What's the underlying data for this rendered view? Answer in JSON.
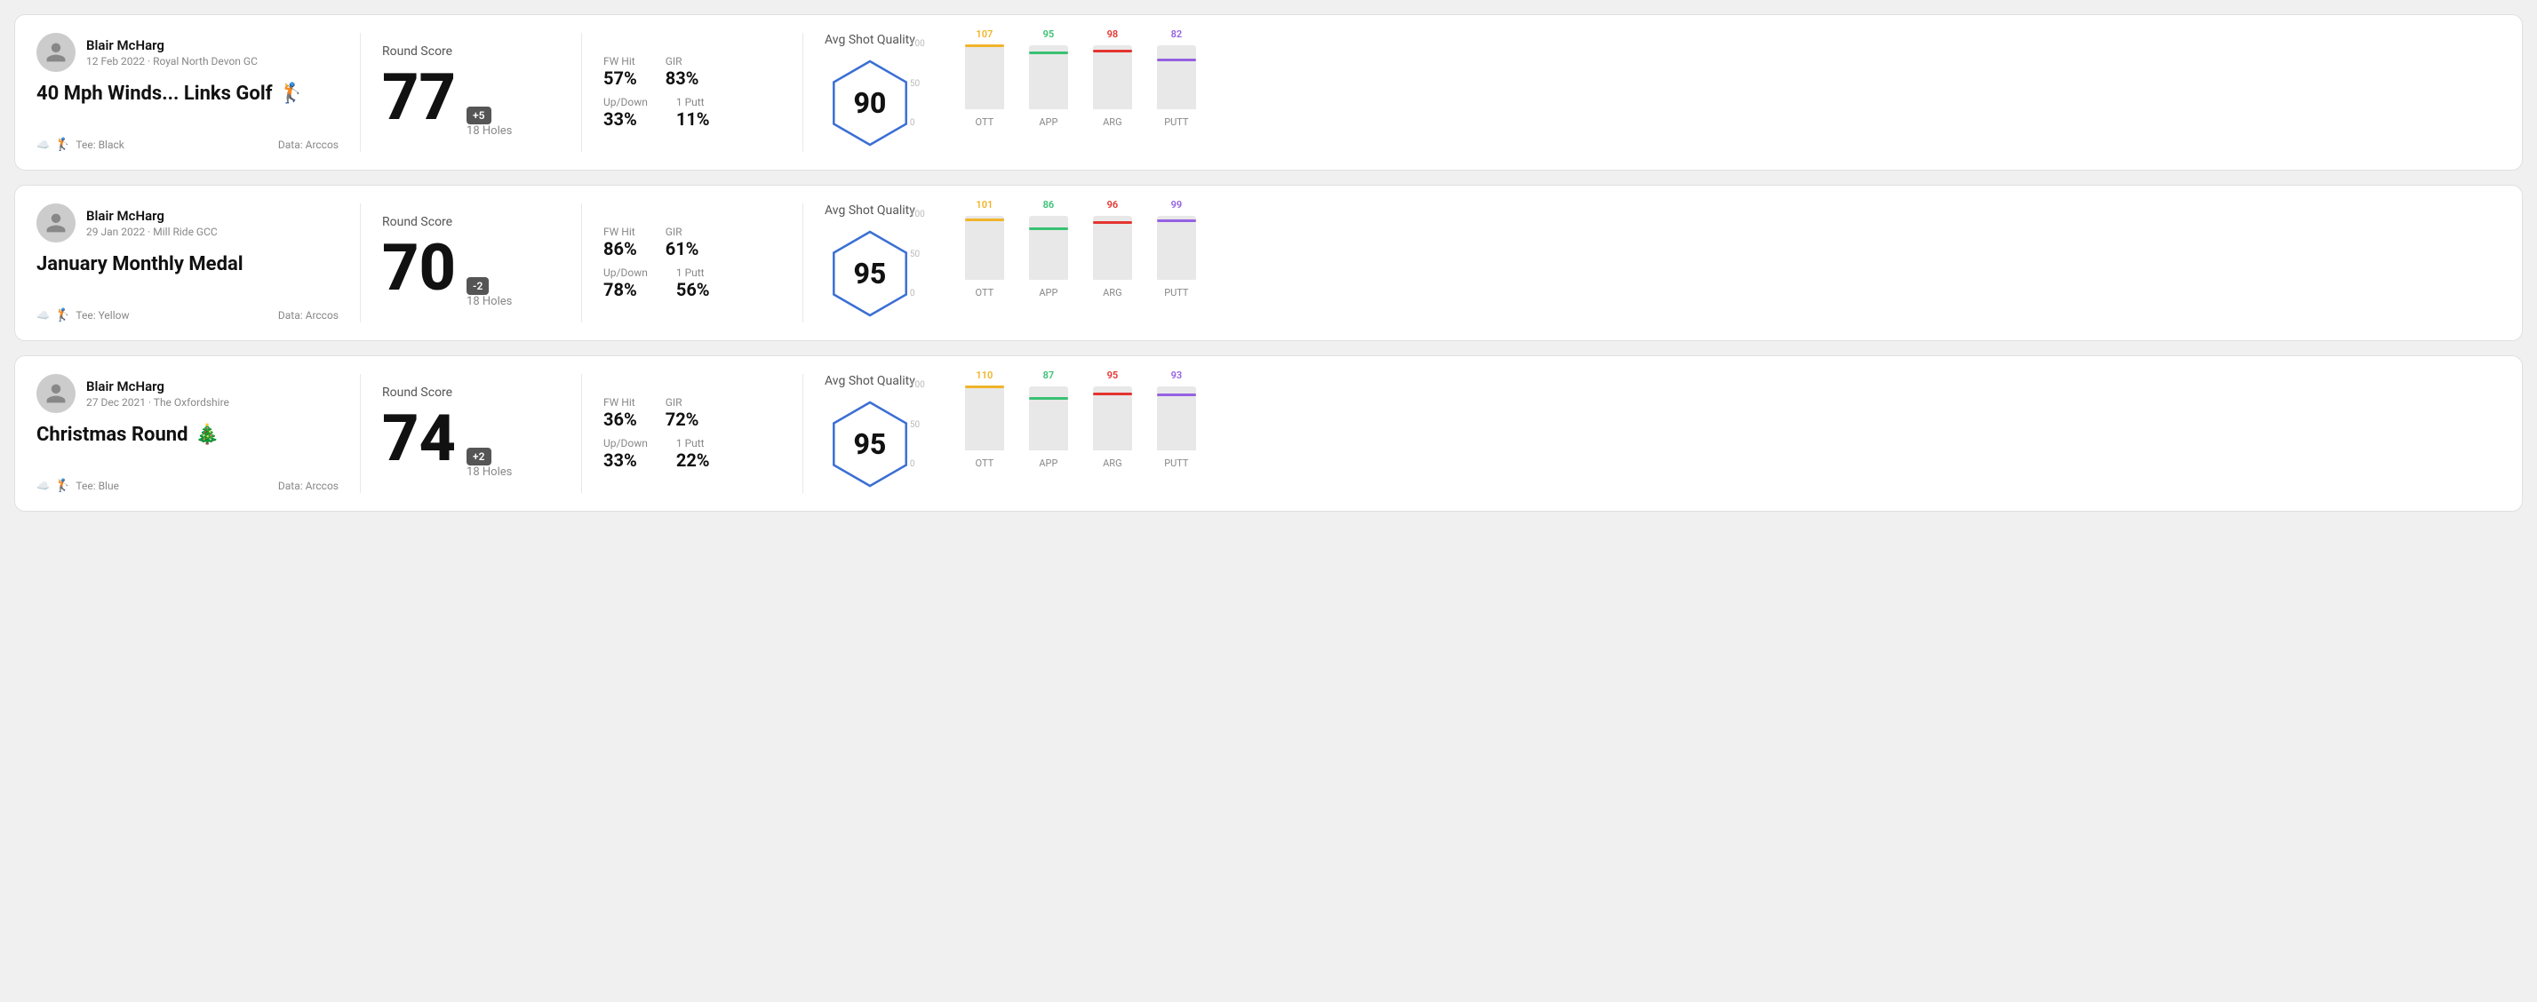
{
  "rounds": [
    {
      "id": "round1",
      "user_name": "Blair McHarg",
      "user_date": "12 Feb 2022 · Royal North Devon GC",
      "round_title": "40 Mph Winds... Links Golf",
      "round_title_emoji": "🏌️",
      "tee": "Tee: Black",
      "data_source": "Data: Arccos",
      "round_score_label": "Round Score",
      "score": "77",
      "score_badge": "+5",
      "holes": "18 Holes",
      "fw_hit_label": "FW Hit",
      "fw_hit_value": "57%",
      "gir_label": "GIR",
      "gir_value": "83%",
      "updown_label": "Up/Down",
      "updown_value": "33%",
      "oneputt_label": "1 Putt",
      "oneputt_value": "11%",
      "quality_label": "Avg Shot Quality",
      "quality_score": "90",
      "chart": {
        "bars": [
          {
            "label": "OTT",
            "value": 107,
            "color": "#f0b429"
          },
          {
            "label": "APP",
            "value": 95,
            "color": "#38c172"
          },
          {
            "label": "ARG",
            "value": 98,
            "color": "#e3342f"
          },
          {
            "label": "PUTT",
            "value": 82,
            "color": "#9561e2"
          }
        ],
        "y_max": 100,
        "y_labels": [
          "100",
          "50",
          "0"
        ]
      }
    },
    {
      "id": "round2",
      "user_name": "Blair McHarg",
      "user_date": "29 Jan 2022 · Mill Ride GCC",
      "round_title": "January Monthly Medal",
      "round_title_emoji": "",
      "tee": "Tee: Yellow",
      "data_source": "Data: Arccos",
      "round_score_label": "Round Score",
      "score": "70",
      "score_badge": "-2",
      "holes": "18 Holes",
      "fw_hit_label": "FW Hit",
      "fw_hit_value": "86%",
      "gir_label": "GIR",
      "gir_value": "61%",
      "updown_label": "Up/Down",
      "updown_value": "78%",
      "oneputt_label": "1 Putt",
      "oneputt_value": "56%",
      "quality_label": "Avg Shot Quality",
      "quality_score": "95",
      "chart": {
        "bars": [
          {
            "label": "OTT",
            "value": 101,
            "color": "#f0b429"
          },
          {
            "label": "APP",
            "value": 86,
            "color": "#38c172"
          },
          {
            "label": "ARG",
            "value": 96,
            "color": "#e3342f"
          },
          {
            "label": "PUTT",
            "value": 99,
            "color": "#9561e2"
          }
        ],
        "y_max": 100,
        "y_labels": [
          "100",
          "50",
          "0"
        ]
      }
    },
    {
      "id": "round3",
      "user_name": "Blair McHarg",
      "user_date": "27 Dec 2021 · The Oxfordshire",
      "round_title": "Christmas Round",
      "round_title_emoji": "🎄",
      "tee": "Tee: Blue",
      "data_source": "Data: Arccos",
      "round_score_label": "Round Score",
      "score": "74",
      "score_badge": "+2",
      "holes": "18 Holes",
      "fw_hit_label": "FW Hit",
      "fw_hit_value": "36%",
      "gir_label": "GIR",
      "gir_value": "72%",
      "updown_label": "Up/Down",
      "updown_value": "33%",
      "oneputt_label": "1 Putt",
      "oneputt_value": "22%",
      "quality_label": "Avg Shot Quality",
      "quality_score": "95",
      "chart": {
        "bars": [
          {
            "label": "OTT",
            "value": 110,
            "color": "#f0b429"
          },
          {
            "label": "APP",
            "value": 87,
            "color": "#38c172"
          },
          {
            "label": "ARG",
            "value": 95,
            "color": "#e3342f"
          },
          {
            "label": "PUTT",
            "value": 93,
            "color": "#9561e2"
          }
        ],
        "y_max": 100,
        "y_labels": [
          "100",
          "50",
          "0"
        ]
      }
    }
  ]
}
